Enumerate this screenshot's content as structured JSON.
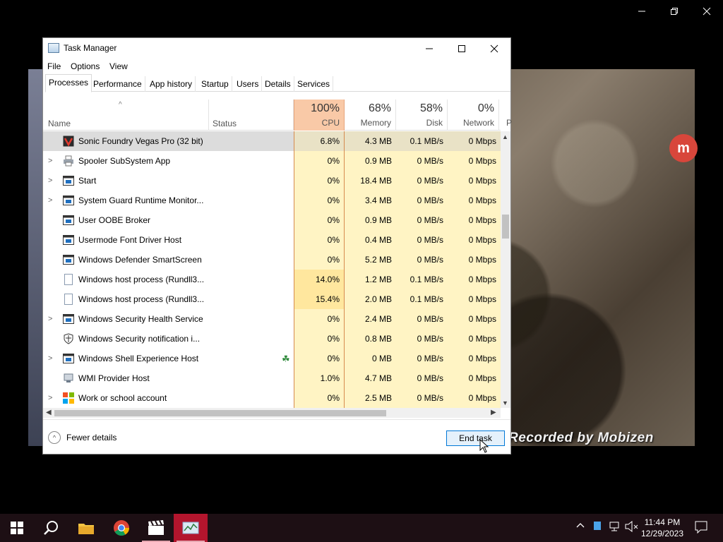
{
  "window": {
    "title": "Task Manager",
    "menu": [
      "File",
      "Options",
      "View"
    ],
    "tabs": [
      "Processes",
      "Performance",
      "App history",
      "Startup",
      "Users",
      "Details",
      "Services"
    ]
  },
  "columns": {
    "name": "Name",
    "status": "Status",
    "cpu": {
      "percent": "100%",
      "label": "CPU"
    },
    "memory": {
      "percent": "68%",
      "label": "Memory"
    },
    "disk": {
      "percent": "58%",
      "label": "Disk"
    },
    "network": {
      "percent": "0%",
      "label": "Network"
    },
    "extra": "P"
  },
  "processes": [
    {
      "name": "Sonic Foundry Vegas Pro (32 bit)",
      "cpu": "6.8%",
      "memory": "4.3 MB",
      "disk": "0.1 MB/s",
      "network": "0 Mbps"
    },
    {
      "name": "Spooler SubSystem App",
      "cpu": "0%",
      "memory": "0.9 MB",
      "disk": "0 MB/s",
      "network": "0 Mbps"
    },
    {
      "name": "Start",
      "cpu": "0%",
      "memory": "18.4 MB",
      "disk": "0 MB/s",
      "network": "0 Mbps"
    },
    {
      "name": "System Guard Runtime Monitor...",
      "cpu": "0%",
      "memory": "3.4 MB",
      "disk": "0 MB/s",
      "network": "0 Mbps"
    },
    {
      "name": "User OOBE Broker",
      "cpu": "0%",
      "memory": "0.9 MB",
      "disk": "0 MB/s",
      "network": "0 Mbps"
    },
    {
      "name": "Usermode Font Driver Host",
      "cpu": "0%",
      "memory": "0.4 MB",
      "disk": "0 MB/s",
      "network": "0 Mbps"
    },
    {
      "name": "Windows Defender SmartScreen",
      "cpu": "0%",
      "memory": "5.2 MB",
      "disk": "0 MB/s",
      "network": "0 Mbps"
    },
    {
      "name": "Windows host process (Rundll3...",
      "cpu": "14.0%",
      "memory": "1.2 MB",
      "disk": "0.1 MB/s",
      "network": "0 Mbps"
    },
    {
      "name": "Windows host process (Rundll3...",
      "cpu": "15.4%",
      "memory": "2.0 MB",
      "disk": "0.1 MB/s",
      "network": "0 Mbps"
    },
    {
      "name": "Windows Security Health Service",
      "cpu": "0%",
      "memory": "2.4 MB",
      "disk": "0 MB/s",
      "network": "0 Mbps"
    },
    {
      "name": "Windows Security notification i...",
      "cpu": "0%",
      "memory": "0.8 MB",
      "disk": "0 MB/s",
      "network": "0 Mbps"
    },
    {
      "name": "Windows Shell Experience Host",
      "cpu": "0%",
      "memory": "0 MB",
      "disk": "0 MB/s",
      "network": "0 Mbps"
    },
    {
      "name": "WMI Provider Host",
      "cpu": "1.0%",
      "memory": "4.7 MB",
      "disk": "0 MB/s",
      "network": "0 Mbps"
    },
    {
      "name": "Work or school account",
      "cpu": "0%",
      "memory": "2.5 MB",
      "disk": "0 MB/s",
      "network": "0 Mbps"
    }
  ],
  "footer": {
    "fewer_details": "Fewer details",
    "end_task": "End task"
  },
  "watermark": "Recorded by Mobizen",
  "taskbar": {
    "time": "11:44 PM",
    "date": "12/29/2023"
  },
  "colors": {
    "cpu_header": "#f9c9a7",
    "cell_bg": "#fff4c4",
    "taskbar": "#1d0f14",
    "taskbar_active": "#b3152d",
    "accent": "#0078d7"
  }
}
